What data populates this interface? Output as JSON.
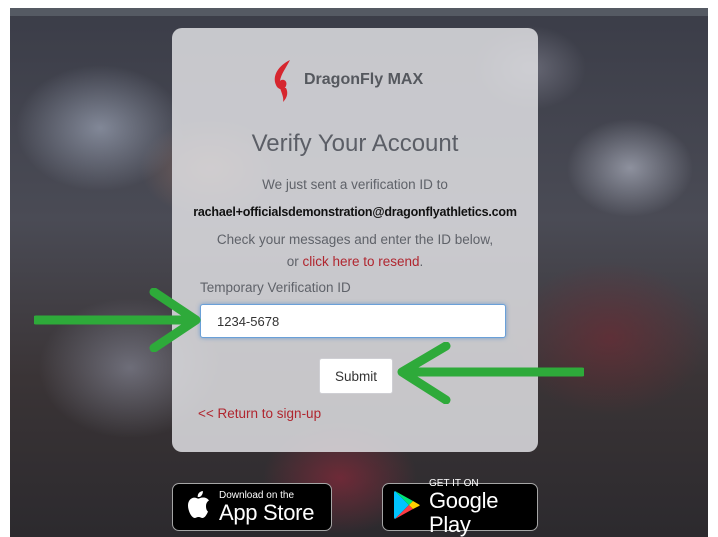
{
  "brand": {
    "name": "DragonFly MAX",
    "icon": "dragonfly-logo-icon",
    "accent": "#d6262e"
  },
  "verify": {
    "title": "Verify Your Account",
    "sent_line": "We just sent a verification ID to",
    "email": "rachael+officialsdemonstration@dragonflyathletics.com",
    "check_line": "Check your messages and enter the ID below,",
    "resend_prefix": "or ",
    "resend_link": "click here to resend",
    "resend_suffix": "."
  },
  "form": {
    "label": "Temporary Verification ID",
    "value": "1234-5678",
    "submit_label": "Submit"
  },
  "back_link": "<< Return to sign-up",
  "stores": {
    "apple": {
      "small": "Download on the",
      "big": "App Store",
      "icon": "apple-icon"
    },
    "google": {
      "small": "GET IT ON",
      "big": "Google Play",
      "icon": "google-play-icon"
    }
  },
  "annotation_color": "#2eaa3a"
}
